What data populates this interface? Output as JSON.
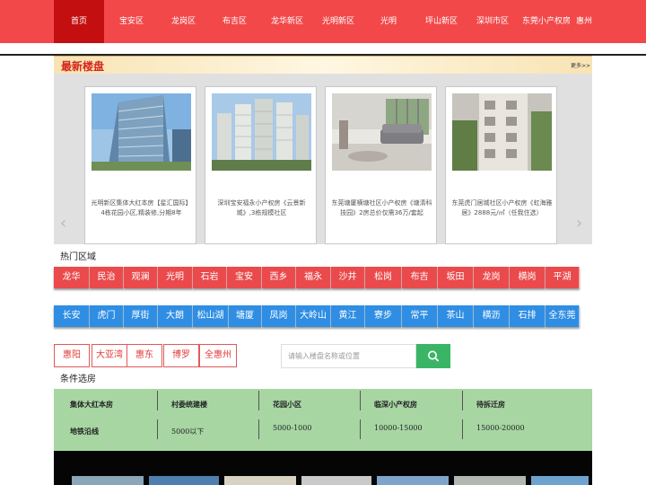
{
  "nav": {
    "items": [
      "首页",
      "宝安区",
      "龙岗区",
      "布吉区",
      "龙华新区",
      "光明新区",
      "光明",
      "坪山新区",
      "深圳市区",
      "东莞小产权房",
      "惠州"
    ],
    "active_index": 0,
    "bg_color": "#f2484a",
    "active_color": "#c40f10"
  },
  "latest": {
    "title": "最新楼盘",
    "more": "更多>>",
    "prev_icon": "‹",
    "next_icon": "›",
    "cards": [
      {
        "caption": "光明新区集体大红本房【星汇国际】4栋花园小区,精装修,分期8年"
      },
      {
        "caption": "深圳宝安福永小产权房《云景新城》,3栋规模社区"
      },
      {
        "caption": "东莞塘厦横塘社区小产权房《塘清科技园》2房总价仅需36万/套起"
      },
      {
        "caption": "东莞虎门居城社区小产权房《虹海雅居》2888元/㎡（任我住选）"
      }
    ]
  },
  "hot_area": {
    "title": "热门区域",
    "row1": [
      "龙华",
      "民治",
      "观澜",
      "光明",
      "石岩",
      "宝安",
      "西乡",
      "福永",
      "沙井",
      "松岗",
      "布吉",
      "坂田",
      "龙岗",
      "横岗",
      "平湖"
    ],
    "row2": [
      "长安",
      "虎门",
      "厚街",
      "大朗",
      "松山湖",
      "塘厦",
      "凤岗",
      "大岭山",
      "黄江",
      "寮步",
      "常平",
      "茶山",
      "横沥",
      "石排",
      "全东莞"
    ],
    "row3": [
      "惠阳",
      "大亚湾",
      "惠东",
      "博罗",
      "全惠州"
    ],
    "red_color": "#ea4a4c",
    "blue_color": "#2f8ee3"
  },
  "search": {
    "placeholder": "请输入楼盘名称或位置",
    "button_icon": "search-icon",
    "button_color": "#3ab566"
  },
  "filter": {
    "title": "条件选房",
    "row1": [
      "集体大红本房",
      "村委统建楼",
      "花园小区",
      "临深小产权房",
      "待拆迁房"
    ],
    "row2": [
      "地铁沿线",
      "5000以下",
      "5000-1000",
      "10000-15000",
      "15000-20000"
    ],
    "bg_color": "#a7d6a3"
  }
}
